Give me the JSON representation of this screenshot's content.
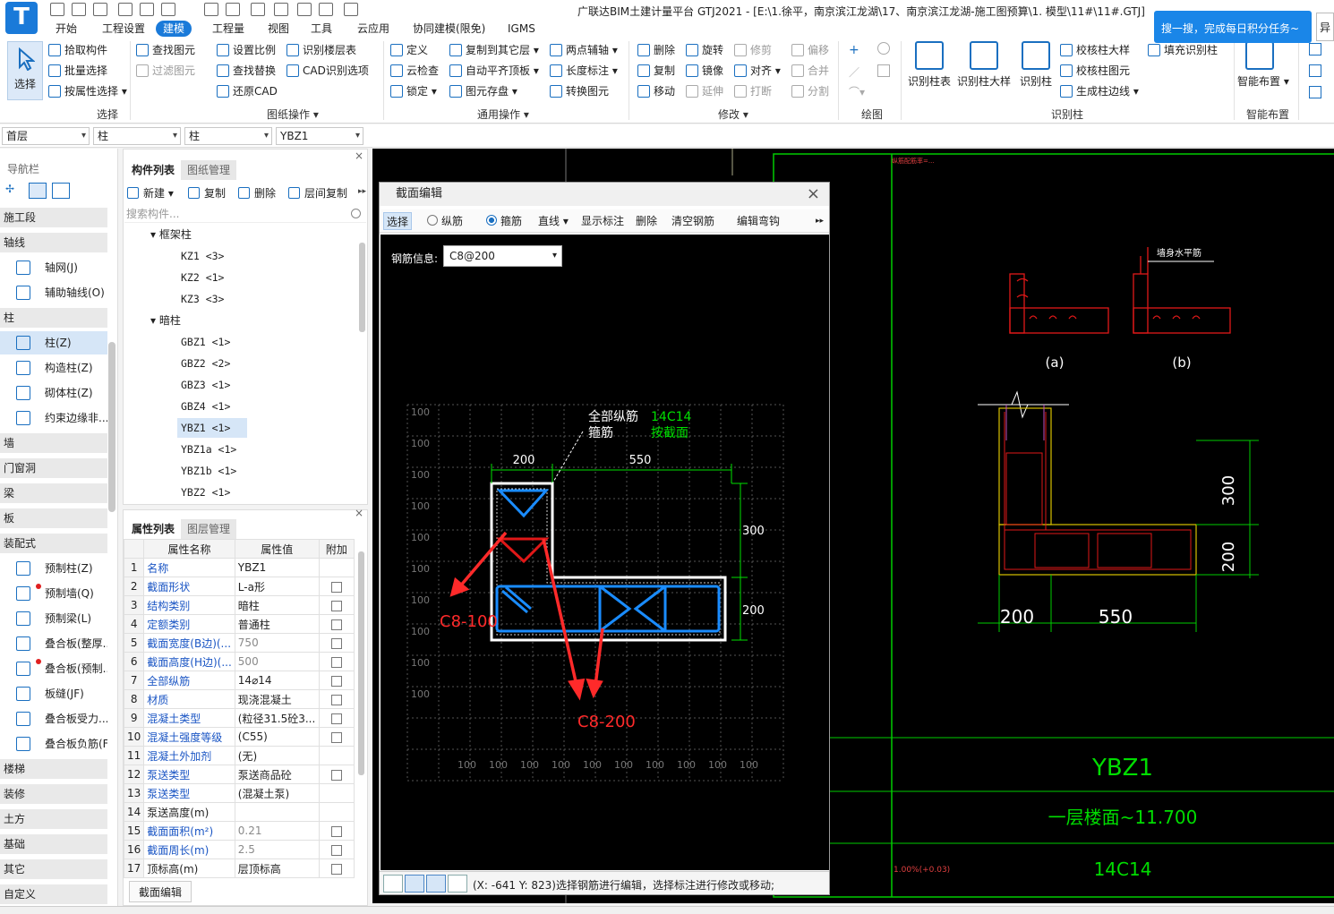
{
  "window": {
    "title": "广联达BIM土建计量平台 GTJ2021 - [E:\\1.徐平，南京滨江龙湖\\17、南京滨江龙湖-施工图预算\\1. 模型\\11#\\11#.GTJ]",
    "promo": "搜一搜，完成每日积分任务~",
    "promo_close": "异"
  },
  "menu": [
    "开始",
    "工程设置",
    "建模",
    "工程量",
    "视图",
    "工具",
    "云应用",
    "协同建模(限免)",
    "IGMS"
  ],
  "ribbon": {
    "select": {
      "big": "选择",
      "items": [
        "拾取构件",
        "批量选择",
        "按属性选择"
      ],
      "label": "选择"
    },
    "drawing": {
      "items": [
        "查找图元",
        "过滤图元",
        "设置比例",
        "查找替换",
        "还原CAD",
        "识别楼层表",
        "CAD识别选项"
      ],
      "label": "图纸操作"
    },
    "general": {
      "items": [
        "定义",
        "云检查",
        "锁定",
        "复制到其它层",
        "自动平齐顶板",
        "图元存盘",
        "两点辅轴",
        "长度标注",
        "转换图元"
      ],
      "label": "通用操作"
    },
    "modify": {
      "items": [
        "删除",
        "复制",
        "移动",
        "旋转",
        "镜像",
        "延伸",
        "修剪",
        "对齐",
        "打断",
        "偏移",
        "合并",
        "分割"
      ],
      "label": "修改"
    },
    "draw": {
      "label": "绘图"
    },
    "recog": {
      "big": [
        "识别柱表",
        "识别柱大样",
        "识别柱"
      ],
      "items": [
        "校核柱大样",
        "校核柱图元",
        "生成柱边线",
        "填充识别柱"
      ],
      "label": "识别柱"
    },
    "smart": {
      "big": "智能布置",
      "label": "智能布置"
    }
  },
  "dropdowns": [
    "首层",
    "柱",
    "柱",
    "YBZ1"
  ],
  "nav": {
    "title": "导航栏",
    "rows": [
      {
        "type": "cat",
        "label": "施工段"
      },
      {
        "type": "cat",
        "label": "轴线"
      },
      {
        "type": "item",
        "label": "轴网(J)",
        "icon": "grid-icon"
      },
      {
        "type": "item",
        "label": "辅助轴线(O)",
        "icon": "aux-axis-icon"
      },
      {
        "type": "cat",
        "label": "柱"
      },
      {
        "type": "item",
        "label": "柱(Z)",
        "icon": "column-icon",
        "active": true
      },
      {
        "type": "item",
        "label": "构造柱(Z)",
        "icon": "constructional-column-icon"
      },
      {
        "type": "item",
        "label": "砌体柱(Z)",
        "icon": "masonry-column-icon"
      },
      {
        "type": "item",
        "label": "约束边缘非...",
        "icon": "boundary-column-icon"
      },
      {
        "type": "cat",
        "label": "墙"
      },
      {
        "type": "cat",
        "label": "门窗洞"
      },
      {
        "type": "cat",
        "label": "梁"
      },
      {
        "type": "cat",
        "label": "板"
      },
      {
        "type": "cat",
        "label": "装配式"
      },
      {
        "type": "item",
        "label": "预制柱(Z)",
        "icon": "precast-column-icon"
      },
      {
        "type": "item",
        "label": "预制墙(Q)",
        "icon": "precast-wall-icon",
        "dot": true
      },
      {
        "type": "item",
        "label": "预制梁(L)",
        "icon": "precast-beam-icon"
      },
      {
        "type": "item",
        "label": "叠合板(整厚...",
        "icon": "composite-slab-icon"
      },
      {
        "type": "item",
        "label": "叠合板(预制...",
        "icon": "composite-slab-precast-icon",
        "dot": true
      },
      {
        "type": "item",
        "label": "板缝(JF)",
        "icon": "slab-joint-icon"
      },
      {
        "type": "item",
        "label": "叠合板受力...",
        "icon": "slab-rebar-icon"
      },
      {
        "type": "item",
        "label": "叠合板负筋(F...",
        "icon": "slab-neg-rebar-icon"
      },
      {
        "type": "cat",
        "label": "楼梯"
      },
      {
        "type": "cat",
        "label": "装修"
      },
      {
        "type": "cat",
        "label": "土方"
      },
      {
        "type": "cat",
        "label": "基础"
      },
      {
        "type": "cat",
        "label": "其它"
      },
      {
        "type": "cat",
        "label": "自定义"
      }
    ]
  },
  "components": {
    "tabs": [
      "构件列表",
      "图纸管理"
    ],
    "toolbar": [
      "新建",
      "复制",
      "删除",
      "层间复制"
    ],
    "search_placeholder": "搜索构件...",
    "groups": [
      {
        "name": "框架柱",
        "items": [
          "KZ1 <3>",
          "KZ2 <1>",
          "KZ3 <3>"
        ]
      },
      {
        "name": "暗柱",
        "items": [
          "GBZ1 <1>",
          "GBZ2 <2>",
          "GBZ3 <1>",
          "GBZ4 <1>",
          "YBZ1 <1>",
          "YBZ1a <1>",
          "YBZ1b <1>",
          "YBZ2 <1>"
        ]
      }
    ],
    "selected": "YBZ1 <1>"
  },
  "properties": {
    "tabs": [
      "属性列表",
      "图层管理"
    ],
    "headers": [
      "属性名称",
      "属性值",
      "附加"
    ],
    "rows": [
      {
        "no": "1",
        "name": "名称",
        "value": "YBZ1",
        "check": false
      },
      {
        "no": "2",
        "name": "截面形状",
        "value": "L-a形",
        "check": true
      },
      {
        "no": "3",
        "name": "结构类别",
        "value": "暗柱",
        "check": true
      },
      {
        "no": "4",
        "name": "定额类别",
        "value": "普通柱",
        "check": true
      },
      {
        "no": "5",
        "name": "截面宽度(B边)(...",
        "value": "750",
        "check": true,
        "gray": true
      },
      {
        "no": "6",
        "name": "截面高度(H边)(...",
        "value": "500",
        "check": true,
        "gray": true
      },
      {
        "no": "7",
        "name": "全部纵筋",
        "value": "14⌀14",
        "check": true
      },
      {
        "no": "8",
        "name": "材质",
        "value": "现浇混凝土",
        "check": true
      },
      {
        "no": "9",
        "name": "混凝土类型",
        "value": "(粒径31.5砼3...",
        "check": true
      },
      {
        "no": "10",
        "name": "混凝土强度等级",
        "value": "(C55)",
        "check": true
      },
      {
        "no": "11",
        "name": "混凝土外加剂",
        "value": "(无)",
        "check": false
      },
      {
        "no": "12",
        "name": "泵送类型",
        "value": "泵送商品砼",
        "check": true
      },
      {
        "no": "13",
        "name": "泵送类型",
        "value": "(混凝土泵)",
        "check": false
      },
      {
        "no": "14",
        "name": "泵送高度(m)",
        "value": "",
        "check": false,
        "plain": true
      },
      {
        "no": "15",
        "name": "截面面积(m²)",
        "value": "0.21",
        "check": true,
        "gray": true
      },
      {
        "no": "16",
        "name": "截面周长(m)",
        "value": "2.5",
        "check": true,
        "gray": true
      },
      {
        "no": "17",
        "name": "顶标高(m)",
        "value": "层顶标高",
        "check": true,
        "plain": true
      }
    ],
    "button": "截面编辑"
  },
  "section_editor": {
    "title": "截面编辑",
    "toolbar": [
      "选择",
      "纵筋",
      "箍筋",
      "直线",
      "显示标注",
      "删除",
      "清空钢筋",
      "编辑弯钩"
    ],
    "mode": "箍筋",
    "rebar_label": "钢筋信息:",
    "rebar_value": "C8@200",
    "status": "(X: -641 Y: 823)选择钢筋进行编辑，选择标注进行修改或移动;",
    "grid_label": "100",
    "annotations": {
      "all_long_label": "全部纵筋",
      "all_long_value": "14C14",
      "stirrup_label": "箍筋",
      "stirrup_value": "按截面",
      "dim_200": "200",
      "dim_550": "550",
      "dim_300": "300",
      "dim_200v": "200",
      "callout_a": "C8-100",
      "callout_b": "C8-200"
    }
  },
  "cad": {
    "detail_a": "(a)",
    "detail_b": "(b)",
    "detail_title": "墙身水平筋",
    "small_note1": "纵筋配筋率=...",
    "dims": {
      "h300": "300",
      "h200": "200",
      "w200": "200",
      "w550": "550"
    },
    "table": {
      "name": "YBZ1",
      "elevation": "一层楼面~11.700",
      "rebar": "14C14",
      "ratio": "1.00%(+0.03)"
    }
  },
  "colors": {
    "accent": "#1a7ad9",
    "cad_bg": "#000000",
    "cad_green": "#00e000",
    "rebar_blue": "#1a8cff",
    "rebar_red": "#e01818",
    "callout_red": "#ff2a2a"
  }
}
